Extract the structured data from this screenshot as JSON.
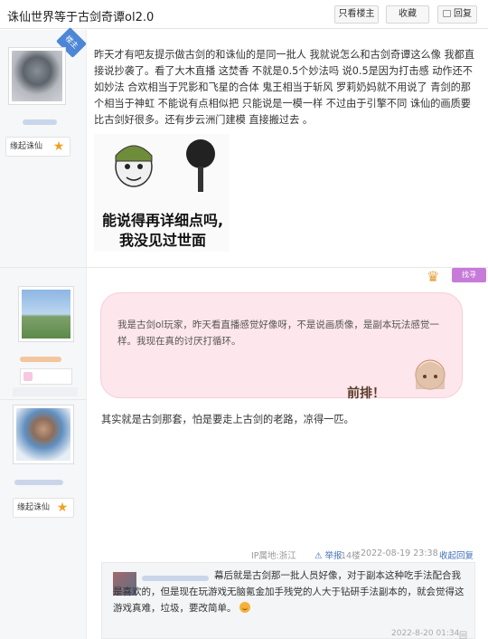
{
  "header": {
    "title": "诛仙世界等于古剑奇谭ol2.0",
    "btn_only_op": "只看楼主",
    "btn_fav": "收藏",
    "btn_reply": "回复"
  },
  "posts": [
    {
      "badge": "楼主",
      "level_name": "缘起诛仙",
      "content": "昨天才有吧友提示做古剑的和诛仙的是同一批人 我就说怎么和古剑奇谭这么像 我都直接说抄袭了。看了大木直播 这焚香 不就是0.5个妙法吗 说0.5是因为打击感 动作还不如妙法 合欢相当于咒影和飞星的合体 鬼王相当于斩风 罗莉奶妈就不用说了 青剑的那个相当于神虹 不能说有点相似把 只能说是一模一样 不过由于引擎不同 诛仙的画质要比古剑好很多。还有步云洲门建模 直接搬过去 。",
      "meme_line1": "能说得再详细点吗,",
      "meme_line2": "我没见过世面"
    },
    {
      "badge_label": "找寻",
      "bubble": "我是古剑ol玩家，昨天看直播感觉好像呀，不是说画质像，是副本玩法感觉一样。我现在真的讨厌打循环。",
      "sticker_text": "前排！"
    },
    {
      "level_name": "缘起诛仙",
      "content": "其实就是古剑那套，怕是要走上古剑的老路，凉得一匹。",
      "meta": {
        "ip": "IP属地:浙江",
        "report": "举报",
        "floor": "14楼",
        "time": "2022-08-19 23:38",
        "reply": "收起回复"
      },
      "reply": {
        "text": "幕后就是古剑那一批人员好像，对于副本这种吃手法配合我是喜欢的，但是现在玩游戏无脑氪金加手残党的人大于钻研手法副本的，就会觉得这游戏真难，垃圾，要改简单。",
        "time": "2022-8-20 01:34",
        "reply_label": "回复"
      }
    }
  ]
}
